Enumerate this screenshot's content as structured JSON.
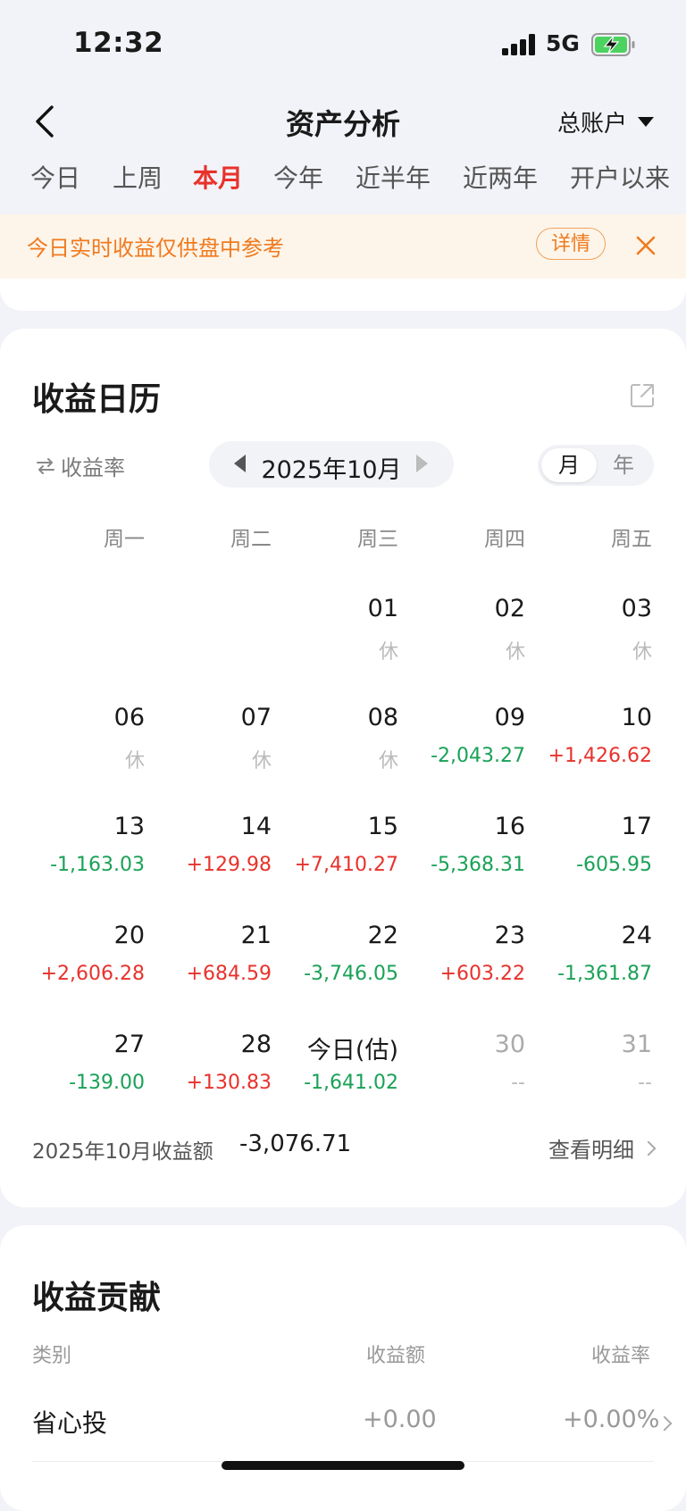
{
  "status": {
    "time": "12:32",
    "network": "5G"
  },
  "header": {
    "title": "资产分析",
    "account": "总账户"
  },
  "tabs": [
    {
      "label": "今日",
      "active": false
    },
    {
      "label": "上周",
      "active": false
    },
    {
      "label": "本月",
      "active": true
    },
    {
      "label": "今年",
      "active": false
    },
    {
      "label": "近半年",
      "active": false
    },
    {
      "label": "近两年",
      "active": false
    },
    {
      "label": "开户以来",
      "active": false
    }
  ],
  "banner": {
    "text": "今日实时收益仅供盘中参考",
    "detail": "详情"
  },
  "calendar": {
    "title": "收益日历",
    "toggle_label": "收益率",
    "month": "2025年10月",
    "seg_month": "月",
    "seg_year": "年",
    "weekdays": [
      "周一",
      "周二",
      "周三",
      "周四",
      "周五"
    ],
    "weeks": [
      [
        null,
        null,
        {
          "day": "01",
          "value": "休",
          "kind": "rest"
        },
        {
          "day": "02",
          "value": "休",
          "kind": "rest"
        },
        {
          "day": "03",
          "value": "休",
          "kind": "rest"
        }
      ],
      [
        {
          "day": "06",
          "value": "休",
          "kind": "rest"
        },
        {
          "day": "07",
          "value": "休",
          "kind": "rest"
        },
        {
          "day": "08",
          "value": "休",
          "kind": "rest"
        },
        {
          "day": "09",
          "value": "-2,043.27",
          "kind": "down"
        },
        {
          "day": "10",
          "value": "+1,426.62",
          "kind": "up"
        }
      ],
      [
        {
          "day": "13",
          "value": "-1,163.03",
          "kind": "down"
        },
        {
          "day": "14",
          "value": "+129.98",
          "kind": "up"
        },
        {
          "day": "15",
          "value": "+7,410.27",
          "kind": "up"
        },
        {
          "day": "16",
          "value": "-5,368.31",
          "kind": "down"
        },
        {
          "day": "17",
          "value": "-605.95",
          "kind": "down"
        }
      ],
      [
        {
          "day": "20",
          "value": "+2,606.28",
          "kind": "up"
        },
        {
          "day": "21",
          "value": "+684.59",
          "kind": "up"
        },
        {
          "day": "22",
          "value": "-3,746.05",
          "kind": "down"
        },
        {
          "day": "23",
          "value": "+603.22",
          "kind": "up"
        },
        {
          "day": "24",
          "value": "-1,361.87",
          "kind": "down"
        }
      ],
      [
        {
          "day": "27",
          "value": "-139.00",
          "kind": "down"
        },
        {
          "day": "28",
          "value": "+130.83",
          "kind": "up"
        },
        {
          "day": "今日(估)",
          "value": "-1,641.02",
          "kind": "down"
        },
        {
          "day": "30",
          "value": "--",
          "kind": "future"
        },
        {
          "day": "31",
          "value": "--",
          "kind": "future"
        }
      ]
    ],
    "summary_label": "2025年10月收益额",
    "summary_value": "-3,076.71",
    "view_detail": "查看明细"
  },
  "contribution": {
    "title": "收益贡献",
    "headers": {
      "category": "类别",
      "amount": "收益额",
      "rate": "收益率"
    },
    "rows": [
      {
        "name": "省心投",
        "amount": "+0.00",
        "rate": "+0.00%"
      }
    ]
  }
}
